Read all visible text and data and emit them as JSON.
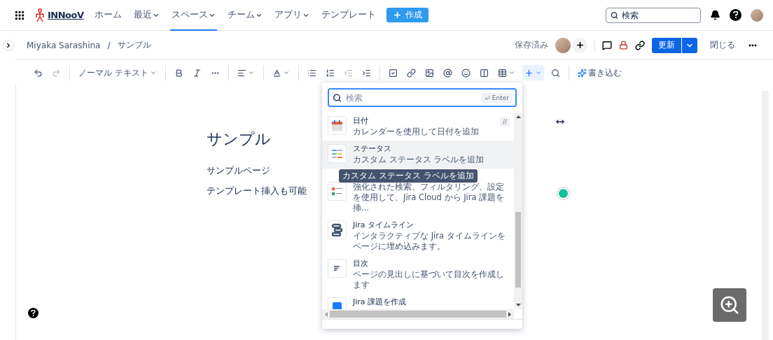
{
  "nav": {
    "logo": "INNooV",
    "items": [
      {
        "label": "ホーム",
        "dropdown": false,
        "selected": false
      },
      {
        "label": "最近",
        "dropdown": true,
        "selected": false
      },
      {
        "label": "スペース",
        "dropdown": true,
        "selected": true
      },
      {
        "label": "チーム",
        "dropdown": true,
        "selected": false
      },
      {
        "label": "アプリ",
        "dropdown": true,
        "selected": false
      },
      {
        "label": "テンプレート",
        "dropdown": false,
        "selected": false
      }
    ],
    "create": "作成",
    "search": {
      "placeholder": "検索"
    }
  },
  "breadcrumb": {
    "items": [
      "Miyaka Sarashina",
      "サンプル"
    ],
    "separator": "/"
  },
  "page_actions": {
    "saved": "保存済み",
    "update": "更新",
    "close": "閉じる"
  },
  "toolbar": {
    "groups": [
      [
        {
          "kind": "undo",
          "disabled": false,
          "active": false
        },
        {
          "kind": "redo",
          "disabled": true,
          "active": false
        }
      ],
      [
        {
          "kind": "text_style",
          "label": "ノーマル テキスト",
          "disabled": false,
          "active": false
        }
      ],
      [
        {
          "kind": "bold",
          "disabled": false,
          "active": false
        },
        {
          "kind": "italic",
          "disabled": false,
          "active": false
        },
        {
          "kind": "more",
          "disabled": false,
          "active": false
        }
      ],
      [
        {
          "kind": "align",
          "disabled": false,
          "active": false
        }
      ],
      [
        {
          "kind": "text_color",
          "disabled": false,
          "active": false
        }
      ],
      [
        {
          "kind": "bullet_list",
          "disabled": false,
          "active": false
        },
        {
          "kind": "numbered_list",
          "disabled": false,
          "active": false
        },
        {
          "kind": "outdent",
          "disabled": true,
          "active": false
        },
        {
          "kind": "indent",
          "disabled": false,
          "active": false
        }
      ],
      [
        {
          "kind": "task",
          "disabled": false,
          "active": false
        },
        {
          "kind": "link",
          "disabled": false,
          "active": false
        },
        {
          "kind": "image",
          "disabled": false,
          "active": false
        },
        {
          "kind": "mention",
          "disabled": false,
          "active": false
        },
        {
          "kind": "emoji",
          "disabled": false,
          "active": false
        },
        {
          "kind": "layout",
          "disabled": false,
          "active": false
        },
        {
          "kind": "table",
          "disabled": false,
          "active": false
        },
        {
          "kind": "insert",
          "disabled": false,
          "active": true
        },
        {
          "kind": "search",
          "disabled": false,
          "active": false
        }
      ],
      [
        {
          "kind": "write",
          "label": "書き込む",
          "disabled": false,
          "active": false
        }
      ]
    ]
  },
  "page": {
    "title": "サンプル",
    "paragraphs": [
      "サンプルページ",
      "テンプレート挿入も可能"
    ]
  },
  "insert_menu": {
    "search": {
      "placeholder": "検索",
      "key_hint": "Enter"
    },
    "items": [
      {
        "kind": "date",
        "title": "日付",
        "description": "カレンダーを使用して日付を追加",
        "shortcut": "//",
        "selected": false
      },
      {
        "kind": "status",
        "title": "ステータス",
        "description": "カスタム ステータス ラベルを追加",
        "selected": true
      },
      {
        "kind": "jira_issues",
        "description": "強化された検索、フィルタリング、設定を使用して、Jira Cloud から Jira 課題を挿...",
        "selected": false
      },
      {
        "kind": "timeline",
        "title": "Jira タイムライン",
        "description": "インタラクティブな Jira タイムラインをページに埋め込みます。",
        "selected": false
      },
      {
        "kind": "toc",
        "title": "目次",
        "description": "ページの見出しに基づいて目次を作成します",
        "selected": false
      },
      {
        "kind": "create_issue",
        "title": "Jira 課題を作成",
        "selected": false
      }
    ],
    "tooltip": "カスタム ステータス ラベルを追加"
  }
}
